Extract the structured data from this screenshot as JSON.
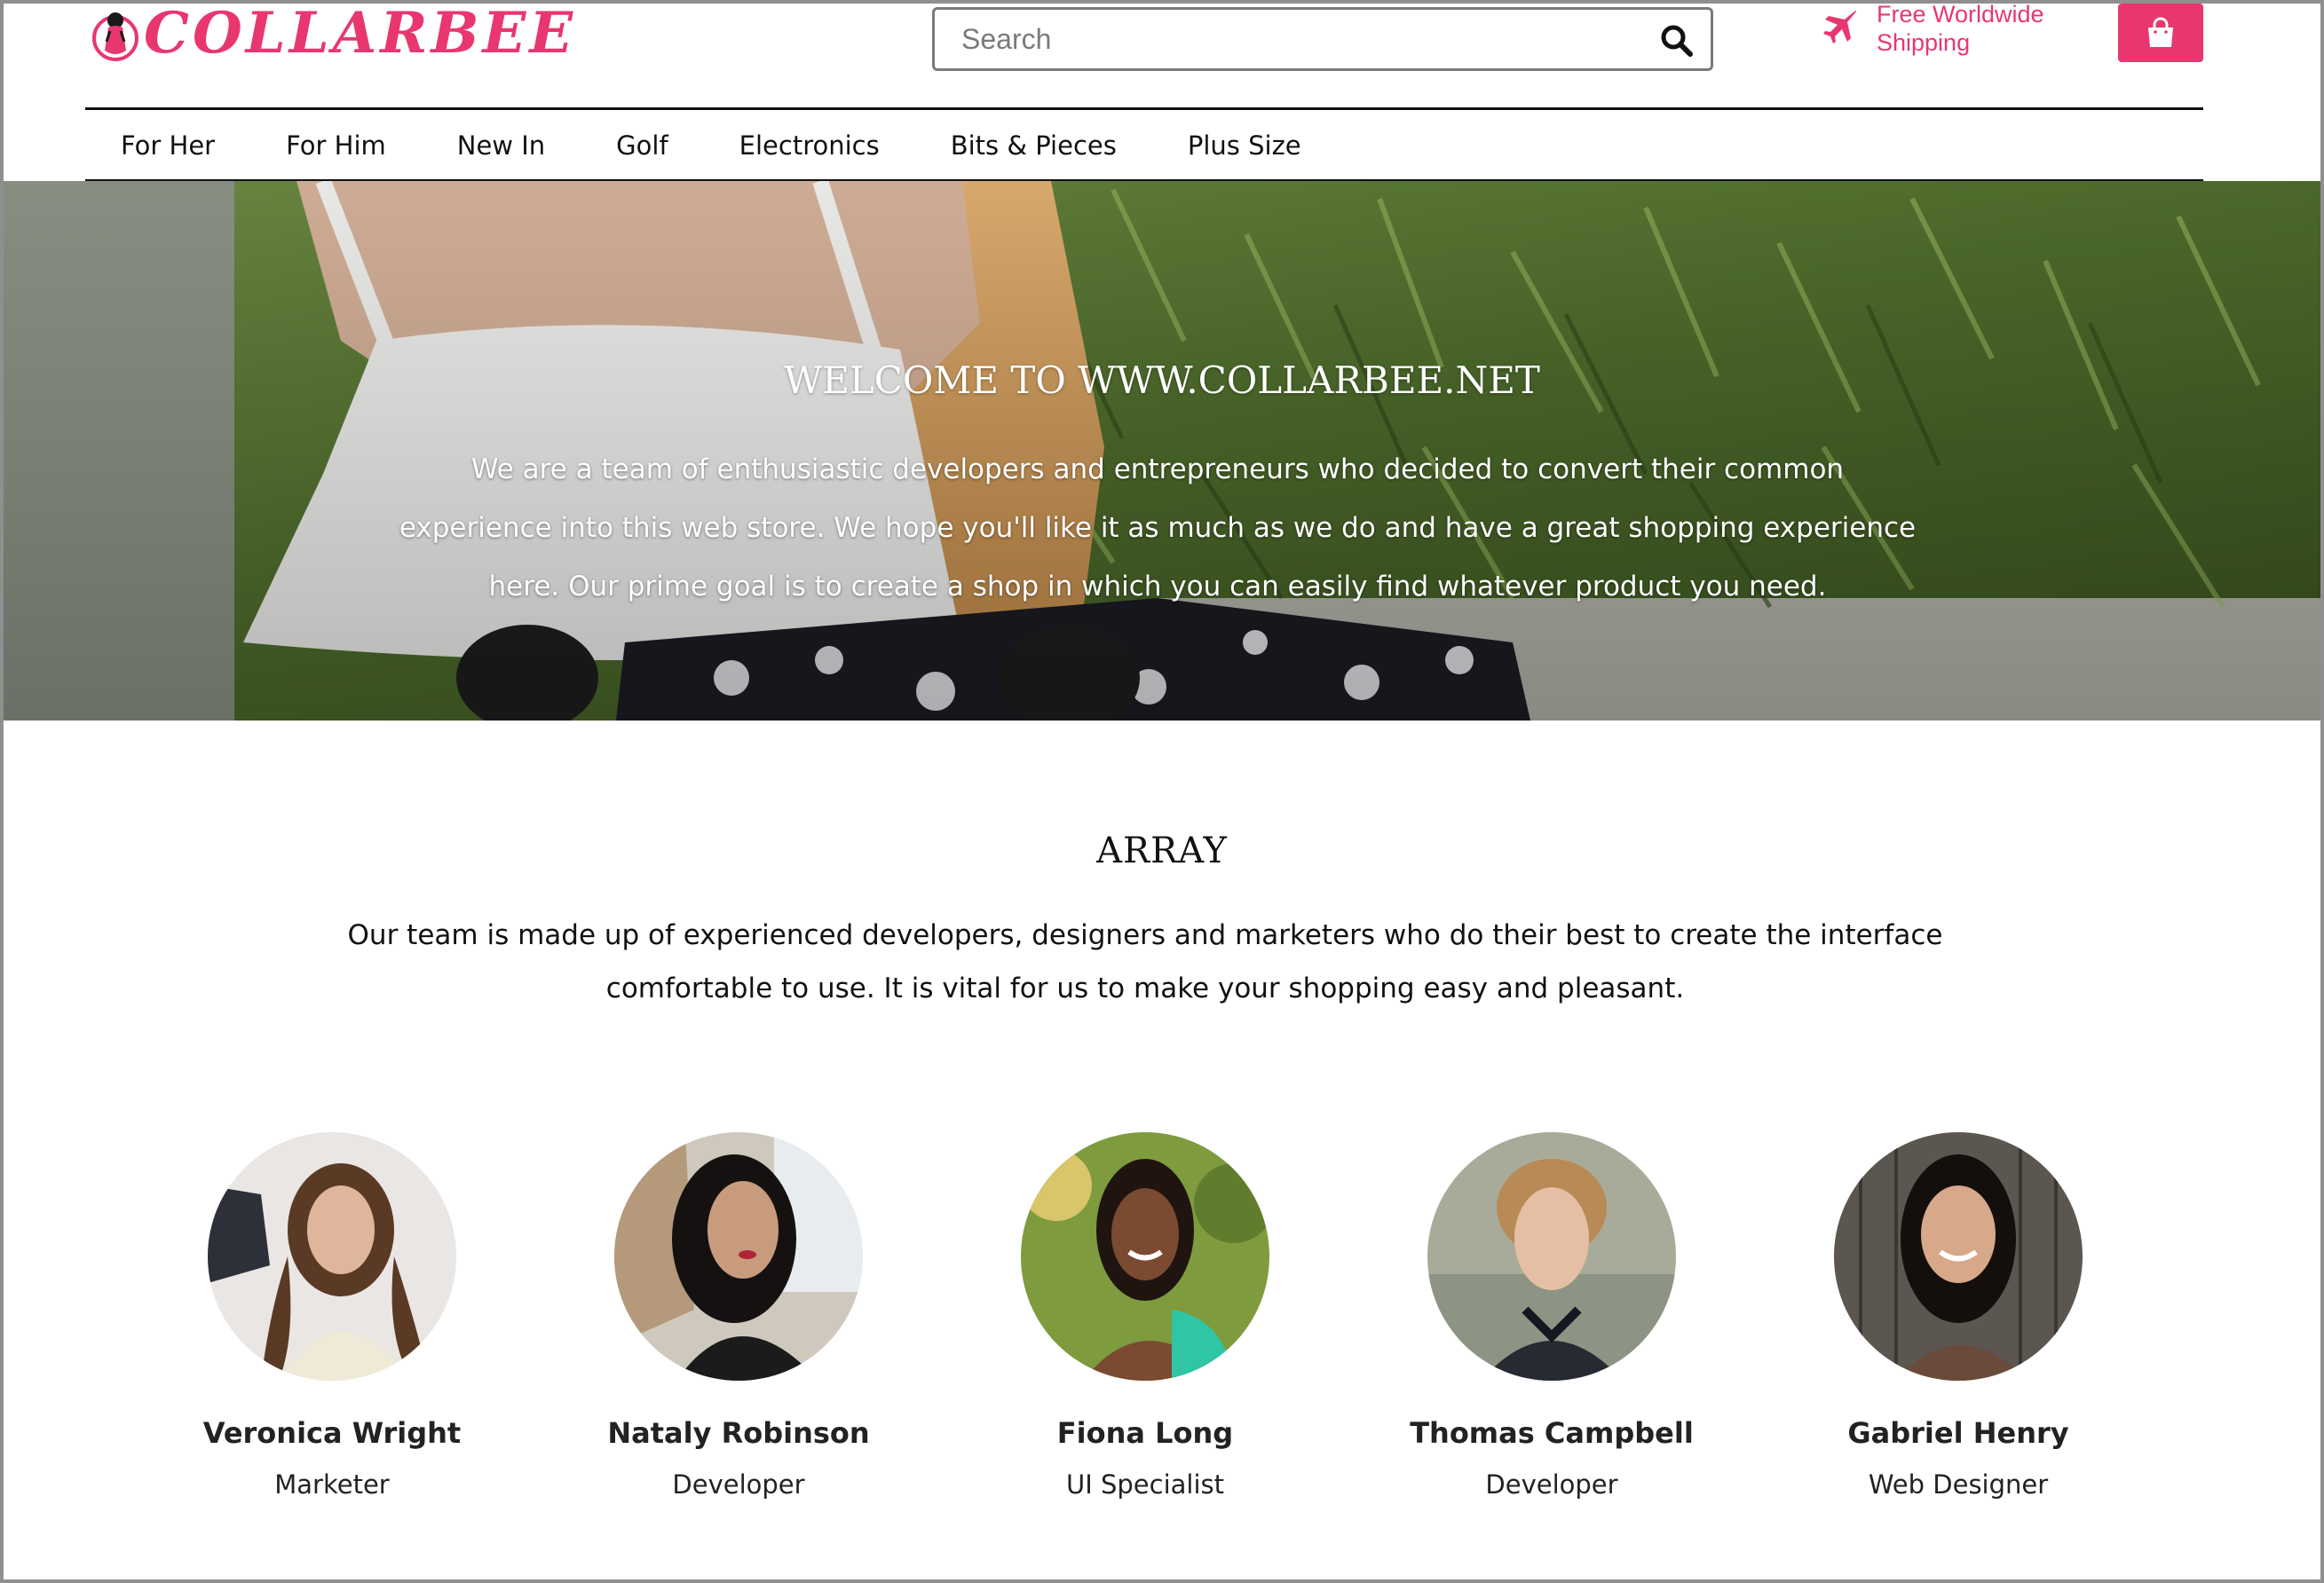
{
  "brand": {
    "logo_text": "COLLARBEE",
    "accent": "#e8376f"
  },
  "header": {
    "search_placeholder": "Search",
    "shipping_line1": "Free Worldwide",
    "shipping_line2": "Shipping",
    "icons": {
      "search": "search-icon",
      "shipping": "airplane-icon",
      "cart": "shopping-bag-icon"
    }
  },
  "nav": {
    "items": [
      "For Her",
      "For Him",
      "New In",
      "Golf",
      "Electronics",
      "Bits & Pieces",
      "Plus Size"
    ]
  },
  "hero": {
    "title": "WELCOME TO WWW.COLLARBEE.NET",
    "text": "We are a team of enthusiastic developers and entrepreneurs who decided to convert their common experience into this web store. We hope you'll like it as much as we do and have a great shopping experience here. Our prime goal is to create a shop in which you can easily find whatever product you need."
  },
  "array": {
    "title": "ARRAY",
    "text": "Our team is made up of experienced developers, designers and marketers who do their best to create the interface comfortable to use. It is vital for us to make your shopping easy and pleasant."
  },
  "team": [
    {
      "name": "Veronica Wright",
      "role": "Marketer"
    },
    {
      "name": "Nataly Robinson",
      "role": "Developer"
    },
    {
      "name": "Fiona Long",
      "role": "UI Specialist"
    },
    {
      "name": "Thomas Campbell",
      "role": "Developer"
    },
    {
      "name": "Gabriel Henry",
      "role": "Web Designer"
    }
  ]
}
